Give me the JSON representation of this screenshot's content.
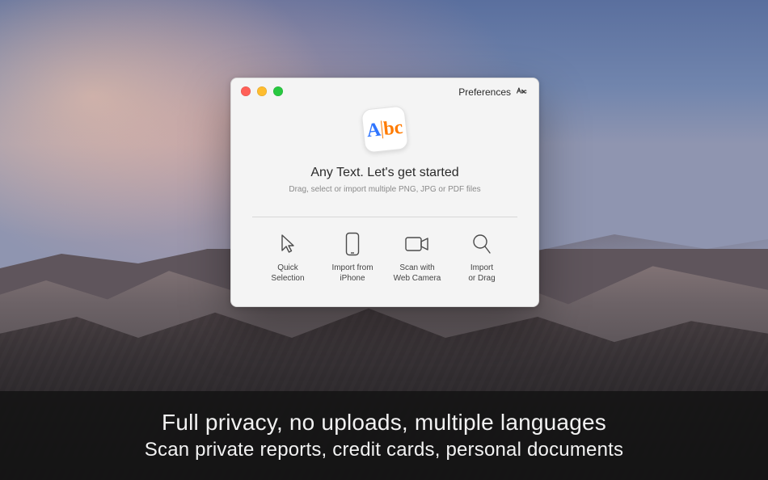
{
  "header": {
    "preferences_label": "Preferences"
  },
  "app_icon": {
    "letter_a": "A",
    "letters_bc": "bc"
  },
  "hero": {
    "title": "Any Text. Let's get started",
    "subtitle": "Drag, select or import multiple PNG, JPG or PDF files"
  },
  "actions": {
    "quick_selection": "Quick\nSelection",
    "import_iphone": "Import from\niPhone",
    "scan_camera": "Scan with\nWeb Camera",
    "import_drag": "Import\nor Drag"
  },
  "caption": {
    "line1": "Full privacy, no uploads, multiple languages",
    "line2": "Scan private reports, credit cards, personal documents"
  }
}
